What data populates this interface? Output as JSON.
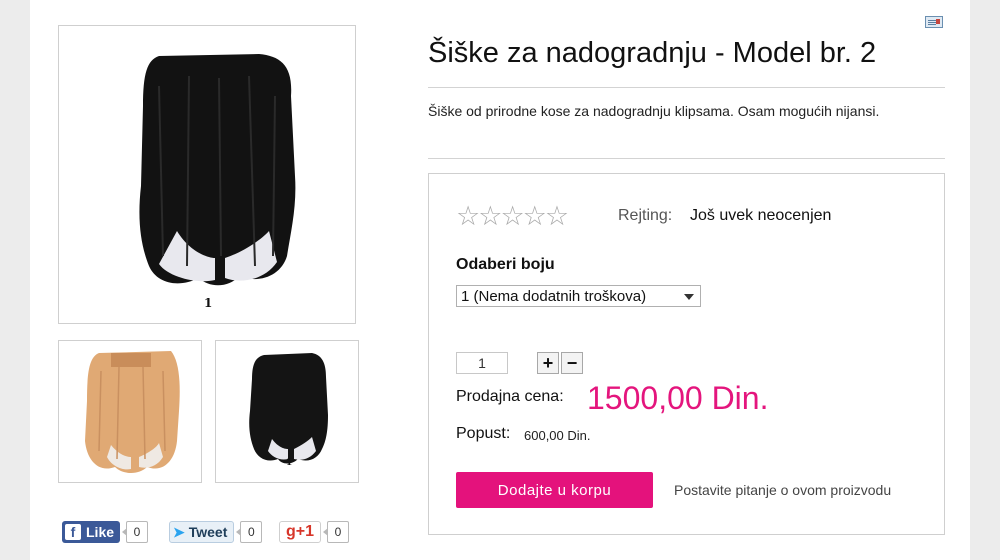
{
  "product": {
    "title": "Šiške za nadogradnju - Model br. 2",
    "description": "Šiške od prirodne kose za nadogradnju klipsama. Osam mogućih nijansi."
  },
  "images": {
    "main_caption": "1",
    "thumb2_caption": "1",
    "hair_colors": {
      "dark": "#111111",
      "blonde": "#e0a974",
      "scalp": "#e9e9ee"
    }
  },
  "rating": {
    "stars_total": 5,
    "label": "Rejting:",
    "value": "Još uvek neocenjen"
  },
  "options": {
    "label": "Odaberi boju",
    "selected": "1 (Nema dodatnih troškova)"
  },
  "quantity": {
    "value": "1",
    "plus": "+",
    "minus": "−"
  },
  "pricing": {
    "price_label": "Prodajna cena:",
    "price_value": "1500,00 Din.",
    "discount_label": "Popust:",
    "discount_value": "600,00 Din.",
    "accent_color": "#e4157d"
  },
  "actions": {
    "add_to_cart": "Dodajte u korpu",
    "ask_question": "Postavite pitanje o ovom proizvodu"
  },
  "social": {
    "facebook_label": "Like",
    "facebook_count": "0",
    "twitter_label": "Tweet",
    "twitter_count": "0",
    "gplus_label": "g+1",
    "gplus_count": "0"
  }
}
